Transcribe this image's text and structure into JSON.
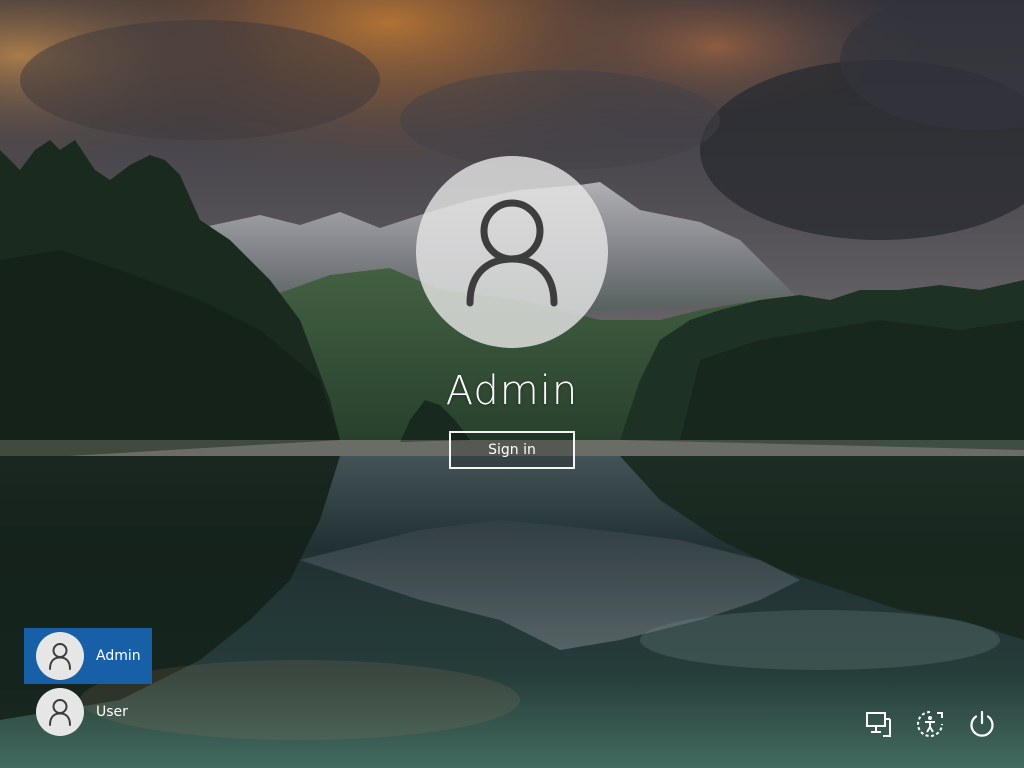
{
  "screen": "Sign-in screen",
  "current_user": {
    "name": "Admin",
    "avatar_icon": "user-silhouette-icon"
  },
  "sign_in": {
    "label": "Sign in"
  },
  "user_list": [
    {
      "name": "Admin",
      "selected": true,
      "avatar_icon": "user-silhouette-icon"
    },
    {
      "name": "User",
      "selected": false,
      "avatar_icon": "user-silhouette-icon"
    }
  ],
  "system_icons": [
    {
      "name": "network-icon"
    },
    {
      "name": "ease-of-access-icon"
    },
    {
      "name": "power-icon"
    }
  ],
  "colors": {
    "selected_tile": "#1760a8",
    "avatar_fill": "#e6e6e6",
    "text": "#ffffff"
  }
}
